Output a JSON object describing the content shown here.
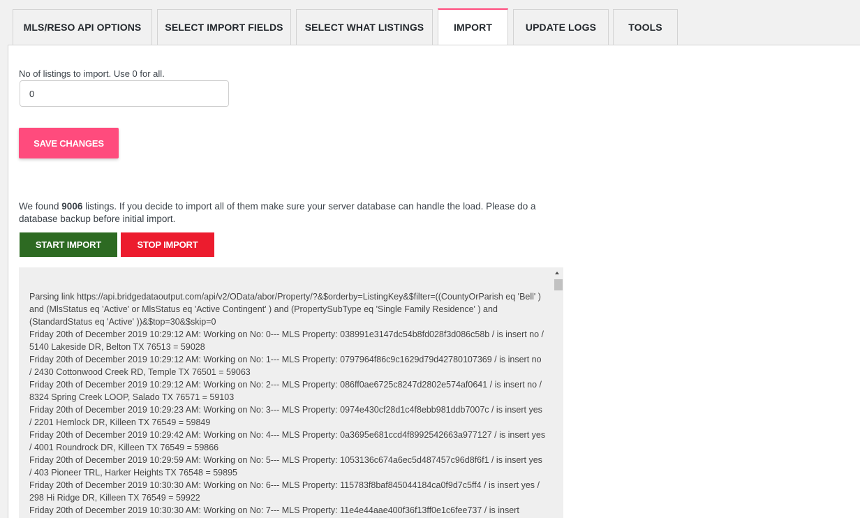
{
  "tabs": [
    {
      "label": "MLS/RESO API OPTIONS",
      "active": false
    },
    {
      "label": "SELECT IMPORT FIELDS",
      "active": false
    },
    {
      "label": "SELECT WHAT LISTINGS",
      "active": false
    },
    {
      "label": "IMPORT",
      "active": true
    },
    {
      "label": "UPDATE LOGS",
      "active": false
    },
    {
      "label": "TOOLS",
      "active": false
    }
  ],
  "form": {
    "listings_label": "No of listings to import. Use 0 for all.",
    "listings_value": "0",
    "save_label": "SAVE CHANGES"
  },
  "found": {
    "prefix": "We found ",
    "count": "9006",
    "suffix": " listings. If you decide to import all of them make sure your server database can handle the load. Please do a database backup before initial import."
  },
  "actions": {
    "start_label": "START IMPORT",
    "stop_label": "STOP IMPORT"
  },
  "log": [
    "Parsing link https://api.bridgedataoutput.com/api/v2/OData/abor/Property/?&$orderby=ListingKey&$filter=((CountyOrParish eq 'Bell' ) and (MlsStatus eq 'Active' or MlsStatus eq 'Active Contingent' ) and (PropertySubType eq 'Single Family Residence' ) and (StandardStatus eq 'Active' ))&$top=30&$skip=0",
    "Friday 20th of December 2019 10:29:12 AM: Working on No: 0--- MLS Property: 038991e3147dc54b8fd028f3d086c58b / is insert no / 5140 Lakeside DR, Belton TX 76513 = 59028",
    "Friday 20th of December 2019 10:29:12 AM: Working on No: 1--- MLS Property: 0797964f86c9c1629d79d42780107369 / is insert no / 2430 Cottonwood Creek RD, Temple TX 76501 = 59063",
    "Friday 20th of December 2019 10:29:12 AM: Working on No: 2--- MLS Property: 086ff0ae6725c8247d2802e574af0641 / is insert no / 8324 Spring Creek LOOP, Salado TX 76571 = 59103",
    "Friday 20th of December 2019 10:29:23 AM: Working on No: 3--- MLS Property: 0974e430cf28d1c4f8ebb981ddb7007c / is insert yes / 2201 Hemlock DR, Killeen TX 76549 = 59849",
    "Friday 20th of December 2019 10:29:42 AM: Working on No: 4--- MLS Property: 0a3695e681ccd4f8992542663a977127 / is insert yes / 4001 Roundrock DR, Killeen TX 76549 = 59866",
    "Friday 20th of December 2019 10:29:59 AM: Working on No: 5--- MLS Property: 1053136c674a6ec5d487457c96d8f6f1 / is insert yes / 403 Pioneer TRL, Harker Heights TX 76548 = 59895",
    "Friday 20th of December 2019 10:30:30 AM: Working on No: 6--- MLS Property: 115783f8baf845044184ca0f9d7c5ff4 / is insert yes / 298 Hi Ridge DR, Killeen TX 76549 = 59922",
    "Friday 20th of December 2019 10:30:30 AM: Working on No: 7--- MLS Property: 11e4e44aae400f36f13ff0e1c6fee737 / is insert"
  ]
}
